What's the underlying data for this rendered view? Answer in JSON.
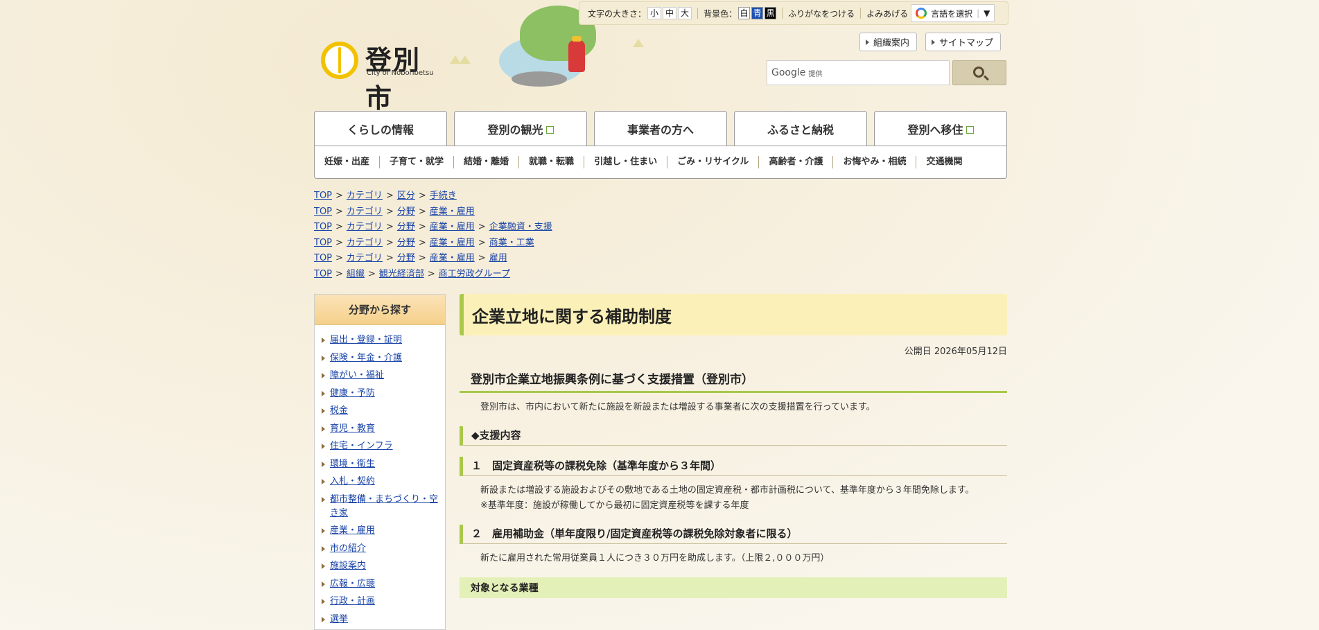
{
  "header": {
    "logo_jp": "登別市",
    "logo_en": "City of Noboribetsu",
    "util": {
      "font_size_label": "文字の大きさ：",
      "font_sizes": [
        "小",
        "中",
        "大"
      ],
      "bg_label": "背景色：",
      "bg_colors": [
        "白",
        "青",
        "黒"
      ],
      "furigana": "ふりがなをつける",
      "read_aloud": "よみあげる",
      "language_select": "言語を選択",
      "language_arrow": "▼"
    },
    "links": [
      "組織案内",
      "サイトマップ"
    ],
    "search": {
      "brand": "Google",
      "sub": "提供"
    }
  },
  "gnav": [
    {
      "label": "くらしの情報",
      "external": false
    },
    {
      "label": "登別の観光",
      "external": true
    },
    {
      "label": "事業者の方へ",
      "external": false
    },
    {
      "label": "ふるさと納税",
      "external": false
    },
    {
      "label": "登別へ移住",
      "external": true
    }
  ],
  "subnav": [
    "妊娠・出産",
    "子育て・就学",
    "結婚・離婚",
    "就職・転職",
    "引越し・住まい",
    "ごみ・リサイクル",
    "高齢者・介護",
    "お悔やみ・相続",
    "交通機関"
  ],
  "breadcrumbs": [
    [
      "TOP",
      "カテゴリ",
      "区分",
      "手続き"
    ],
    [
      "TOP",
      "カテゴリ",
      "分野",
      "産業・雇用"
    ],
    [
      "TOP",
      "カテゴリ",
      "分野",
      "産業・雇用",
      "企業融資・支援"
    ],
    [
      "TOP",
      "カテゴリ",
      "分野",
      "産業・雇用",
      "商業・工業"
    ],
    [
      "TOP",
      "カテゴリ",
      "分野",
      "産業・雇用",
      "雇用"
    ],
    [
      "TOP",
      "組織",
      "観光経済部",
      "商工労政グループ"
    ]
  ],
  "breadcrumb_sep": ">",
  "sidebar": {
    "title": "分野から探す",
    "items": [
      "届出・登録・証明",
      "保険・年金・介護",
      "障がい・福祉",
      "健康・予防",
      "税金",
      "育児・教育",
      "住宅・インフラ",
      "環境・衛生",
      "入札・契約",
      "都市整備・まちづくり・空き家",
      "産業・雇用",
      "市の紹介",
      "施設案内",
      "広報・広聴",
      "行政・計画",
      "選挙"
    ]
  },
  "main": {
    "title": "企業立地に関する補助制度",
    "date": "公開日 2026年05月12日",
    "h2": "登別市企業立地振興条例に基づく支援措置（登別市）",
    "intro": "登別市は、市内において新たに施設を新設または増設する事業者に次の支援措置を行っています。",
    "h3_support": "◆支援内容",
    "h3_1": "１　固定資産税等の課税免除（基準年度から３年間）",
    "p1": "新設または増設する施設およびその敷地である土地の固定資産税・都市計画税について、基準年度から３年間免除します。",
    "p1_note": "※基準年度：施設が稼働してから最初に固定資産税等を課する年度",
    "h3_2": "２　雇用補助金（単年度限り/固定資産税等の課税免除対象者に限る）",
    "p2": "新たに雇用された常用従業員１人につき３０万円を助成します。（上限２,０００万円）",
    "h4": "対象となる業種"
  }
}
